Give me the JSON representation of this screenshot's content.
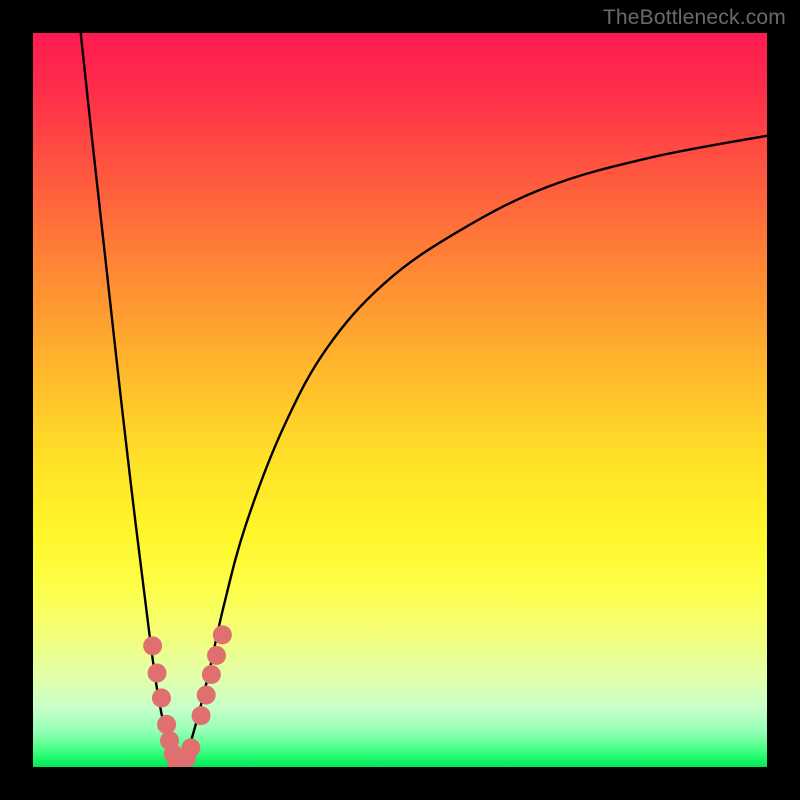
{
  "watermark": "TheBottleneck.com",
  "colors": {
    "frame": "#000000",
    "curve_stroke": "#000000",
    "marker_fill": "#e07070",
    "marker_stroke": "#c85a5a"
  },
  "chart_data": {
    "type": "line",
    "title": "",
    "xlabel": "",
    "ylabel": "",
    "xlim": [
      0,
      100
    ],
    "ylim": [
      0,
      100
    ],
    "note": "No axes, ticks, or numeric labels are rendered in the image; values below are estimated from pixel positions on a 0–100 normalized scale (y=0 at bottom, y=100 at top).",
    "series": [
      {
        "name": "left-branch",
        "x": [
          6.5,
          8,
          10,
          12,
          14,
          16,
          17,
          18,
          19,
          19.8
        ],
        "y": [
          100,
          86,
          68,
          50,
          33,
          17,
          10,
          5,
          1.5,
          0.4
        ]
      },
      {
        "name": "right-branch",
        "x": [
          19.8,
          21,
          22.5,
          24,
          26,
          29,
          34,
          40,
          48,
          58,
          70,
          84,
          100
        ],
        "y": [
          0.4,
          2,
          7,
          13,
          22,
          33,
          46,
          57,
          66,
          73,
          79,
          83,
          86
        ]
      }
    ],
    "markers": {
      "name": "highlighted-points",
      "points": [
        {
          "x": 16.3,
          "y": 16.5
        },
        {
          "x": 16.9,
          "y": 12.8
        },
        {
          "x": 17.5,
          "y": 9.4
        },
        {
          "x": 18.2,
          "y": 5.8
        },
        {
          "x": 18.6,
          "y": 3.6
        },
        {
          "x": 19.1,
          "y": 1.8
        },
        {
          "x": 19.6,
          "y": 0.7
        },
        {
          "x": 20.2,
          "y": 0.5
        },
        {
          "x": 20.9,
          "y": 1.2
        },
        {
          "x": 21.5,
          "y": 2.6
        },
        {
          "x": 22.9,
          "y": 7.0
        },
        {
          "x": 23.6,
          "y": 9.8
        },
        {
          "x": 24.3,
          "y": 12.6
        },
        {
          "x": 25.0,
          "y": 15.2
        },
        {
          "x": 25.8,
          "y": 18.0
        }
      ]
    }
  }
}
